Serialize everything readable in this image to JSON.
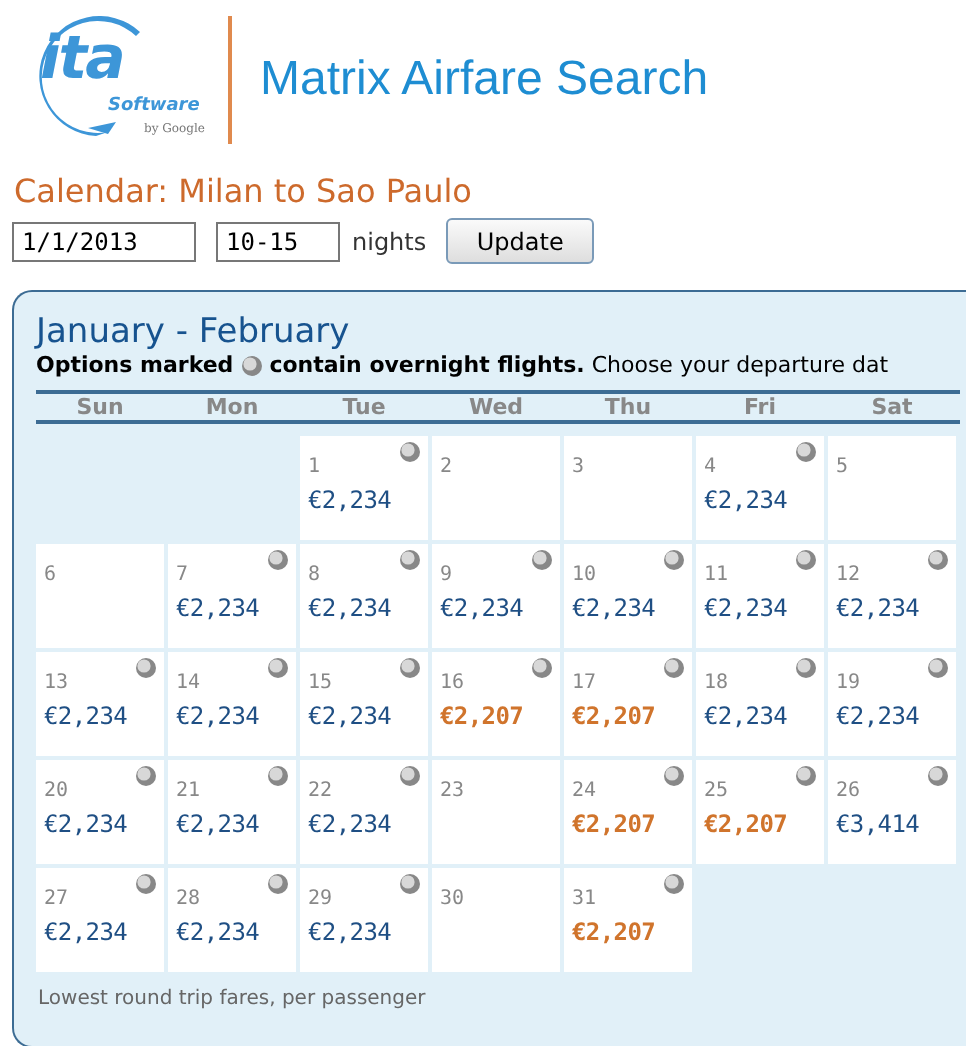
{
  "logo": {
    "mark": "ita",
    "word": "Software",
    "byline": "by Google"
  },
  "app_title": "Matrix Airfare Search",
  "page_heading": "Calendar: Milan to Sao Paulo",
  "form": {
    "date": "1/1/2013",
    "nights": "10-15",
    "nights_label": "nights",
    "button": "Update"
  },
  "calendar": {
    "title": "January - February",
    "legend_before": "Options marked",
    "legend_after": "**contain overnight flights.** Choose your departure dat",
    "weekdays": [
      "Sun",
      "Mon",
      "Tue",
      "Wed",
      "Thu",
      "Fri",
      "Sat"
    ],
    "cells": [
      {
        "kind": "blank"
      },
      {
        "kind": "blank"
      },
      {
        "kind": "day",
        "day": "1",
        "overnight": true,
        "price": "€2,234",
        "cheapest": false
      },
      {
        "kind": "day",
        "day": "2",
        "overnight": false
      },
      {
        "kind": "day",
        "day": "3",
        "overnight": false
      },
      {
        "kind": "day",
        "day": "4",
        "overnight": true,
        "price": "€2,234",
        "cheapest": false
      },
      {
        "kind": "day",
        "day": "5",
        "overnight": false
      },
      {
        "kind": "day",
        "day": "6",
        "overnight": false
      },
      {
        "kind": "day",
        "day": "7",
        "overnight": true,
        "price": "€2,234",
        "cheapest": false
      },
      {
        "kind": "day",
        "day": "8",
        "overnight": true,
        "price": "€2,234",
        "cheapest": false
      },
      {
        "kind": "day",
        "day": "9",
        "overnight": true,
        "price": "€2,234",
        "cheapest": false
      },
      {
        "kind": "day",
        "day": "10",
        "overnight": true,
        "price": "€2,234",
        "cheapest": false
      },
      {
        "kind": "day",
        "day": "11",
        "overnight": true,
        "price": "€2,234",
        "cheapest": false
      },
      {
        "kind": "day",
        "day": "12",
        "overnight": true,
        "price": "€2,234",
        "cheapest": false
      },
      {
        "kind": "day",
        "day": "13",
        "overnight": true,
        "price": "€2,234",
        "cheapest": false
      },
      {
        "kind": "day",
        "day": "14",
        "overnight": true,
        "price": "€2,234",
        "cheapest": false
      },
      {
        "kind": "day",
        "day": "15",
        "overnight": true,
        "price": "€2,234",
        "cheapest": false
      },
      {
        "kind": "day",
        "day": "16",
        "overnight": true,
        "price": "€2,207",
        "cheapest": true
      },
      {
        "kind": "day",
        "day": "17",
        "overnight": true,
        "price": "€2,207",
        "cheapest": true
      },
      {
        "kind": "day",
        "day": "18",
        "overnight": true,
        "price": "€2,234",
        "cheapest": false
      },
      {
        "kind": "day",
        "day": "19",
        "overnight": true,
        "price": "€2,234",
        "cheapest": false
      },
      {
        "kind": "day",
        "day": "20",
        "overnight": true,
        "price": "€2,234",
        "cheapest": false
      },
      {
        "kind": "day",
        "day": "21",
        "overnight": true,
        "price": "€2,234",
        "cheapest": false
      },
      {
        "kind": "day",
        "day": "22",
        "overnight": true,
        "price": "€2,234",
        "cheapest": false
      },
      {
        "kind": "day",
        "day": "23",
        "overnight": false
      },
      {
        "kind": "day",
        "day": "24",
        "overnight": true,
        "price": "€2,207",
        "cheapest": true
      },
      {
        "kind": "day",
        "day": "25",
        "overnight": true,
        "price": "€2,207",
        "cheapest": true
      },
      {
        "kind": "day",
        "day": "26",
        "overnight": true,
        "price": "€3,414",
        "cheapest": false
      },
      {
        "kind": "day",
        "day": "27",
        "overnight": true,
        "price": "€2,234",
        "cheapest": false
      },
      {
        "kind": "day",
        "day": "28",
        "overnight": true,
        "price": "€2,234",
        "cheapest": false
      },
      {
        "kind": "day",
        "day": "29",
        "overnight": true,
        "price": "€2,234",
        "cheapest": false
      },
      {
        "kind": "day",
        "day": "30",
        "overnight": false
      },
      {
        "kind": "day",
        "day": "31",
        "overnight": true,
        "price": "€2,207",
        "cheapest": true
      },
      {
        "kind": "blank"
      },
      {
        "kind": "blank"
      }
    ],
    "footnote": "Lowest round trip fares, per passenger"
  }
}
